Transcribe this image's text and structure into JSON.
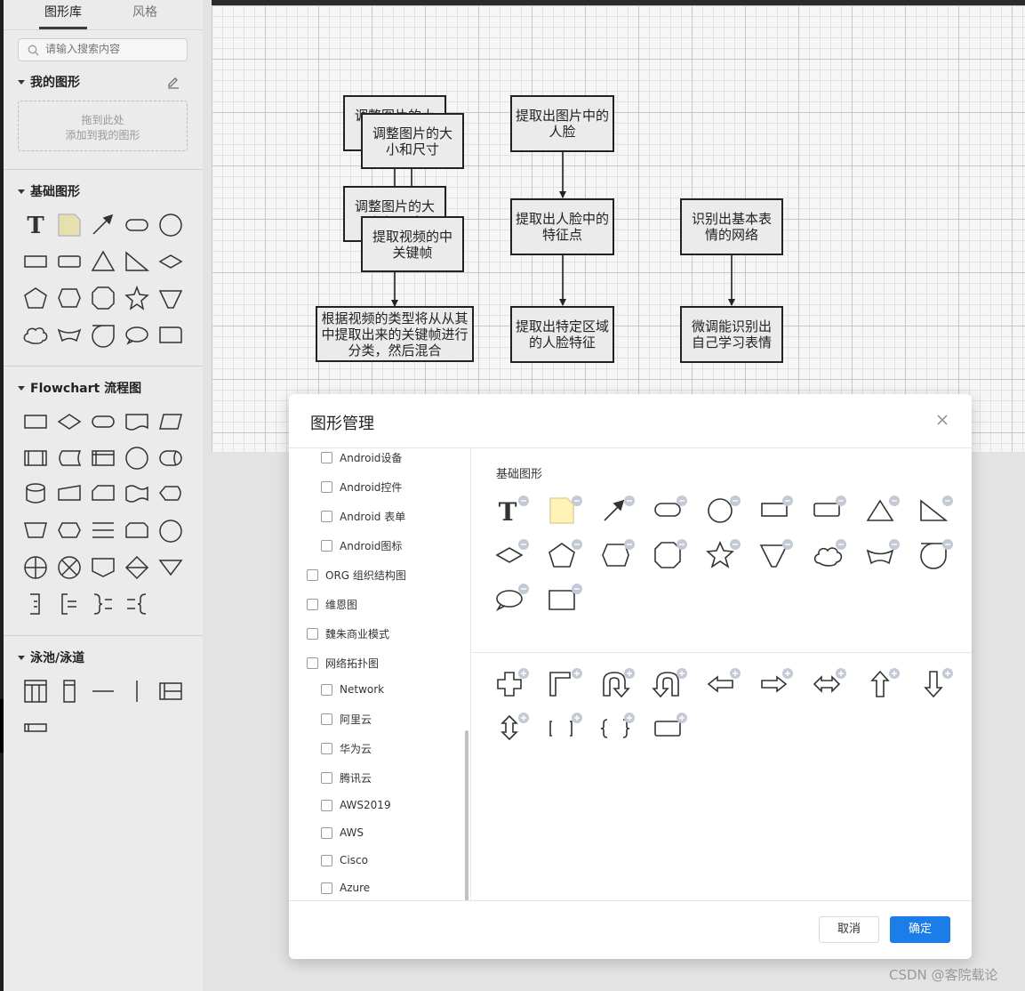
{
  "sidebar": {
    "tabs": [
      "图形库",
      "风格"
    ],
    "search_placeholder": "请输入搜索内容",
    "my_shapes": {
      "title": "我的图形",
      "drop_line1": "拖到此处",
      "drop_line2": "添加到我的图形"
    },
    "basic_title": "基础图形",
    "flowchart_title": "Flowchart 流程图",
    "pool_title": "泳池/泳道"
  },
  "canvas": {
    "nodes": [
      {
        "id": "n1",
        "text": "调整图片的大小和尺寸"
      },
      {
        "id": "n2",
        "text": "调整图片的大小和尺寸"
      },
      {
        "id": "n3",
        "text": "调整图片的大小和尺寸"
      },
      {
        "id": "n4",
        "text": "提取视频的中关键帧"
      },
      {
        "id": "n5",
        "text": "根据视频的类型将从从其中提取出来的关键帧进行分类，然后混合"
      },
      {
        "id": "n6",
        "text": "提取出图片中的人脸"
      },
      {
        "id": "n7",
        "text": "提取出人脸中的特征点"
      },
      {
        "id": "n8",
        "text": "提取出特定区域的人脸特征"
      },
      {
        "id": "n9",
        "text": "识别出基本表情的网络"
      },
      {
        "id": "n10",
        "text": "微调能识别出自己学习表情"
      }
    ]
  },
  "dialog": {
    "title": "图形管理",
    "categories": [
      {
        "label": "Android设备",
        "level": 2
      },
      {
        "label": "Android控件",
        "level": 2
      },
      {
        "label": "Android 表单",
        "level": 2
      },
      {
        "label": "Android图标",
        "level": 2
      },
      {
        "label": "ORG 组织结构图",
        "level": 1
      },
      {
        "label": "维恩图",
        "level": 1
      },
      {
        "label": "魏朱商业模式",
        "level": 1
      },
      {
        "label": "网络拓扑图",
        "level": 1
      },
      {
        "label": "Network",
        "level": 2
      },
      {
        "label": "阿里云",
        "level": 2
      },
      {
        "label": "华为云",
        "level": 2
      },
      {
        "label": "腾讯云",
        "level": 2
      },
      {
        "label": "AWS2019",
        "level": 2
      },
      {
        "label": "AWS",
        "level": 2
      },
      {
        "label": "Cisco",
        "level": 2
      },
      {
        "label": "Azure",
        "level": 2
      }
    ],
    "selected_group": "基础图形",
    "cancel": "取消",
    "ok": "确定"
  },
  "watermark": "CSDN @客院载论",
  "colors": {
    "primary": "#1b7de7",
    "badge": "#c4c9d6",
    "note": "#fff3b8"
  }
}
